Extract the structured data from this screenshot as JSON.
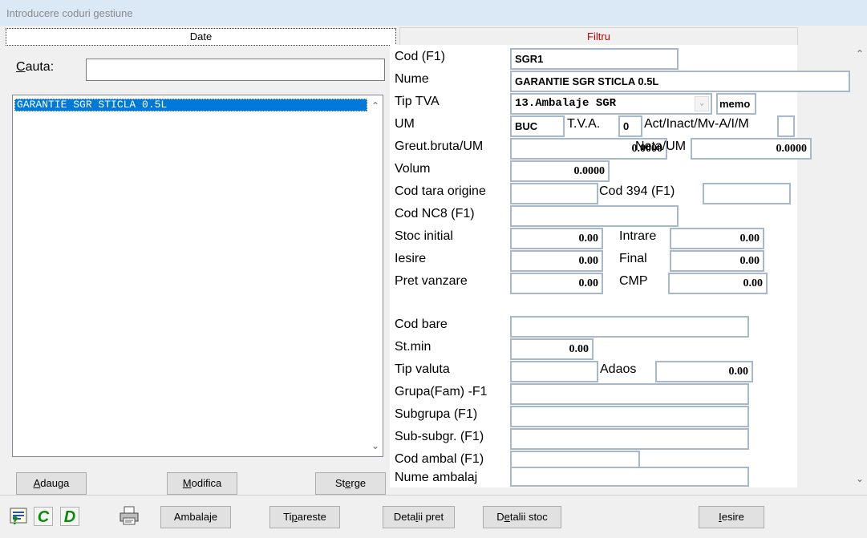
{
  "window": {
    "title": "Introducere coduri gestiune"
  },
  "tabs": {
    "date": "Date",
    "filtru": "Filtru"
  },
  "search": {
    "label_first": "C",
    "label_rest": "auta:",
    "value": ""
  },
  "list": {
    "items": [
      "GARANTIE SGR STICLA 0.5L"
    ]
  },
  "left_buttons": {
    "adauga_first": "A",
    "adauga_rest": "dauga",
    "modifica_first": "M",
    "modifica_rest": "odifica",
    "sterge_pre": "St",
    "sterge_u": "e",
    "sterge_post": "rge"
  },
  "form": {
    "cod_label": "Cod (F1)",
    "cod_value": "SGR1",
    "nume_label": "Nume",
    "nume_value": "GARANTIE SGR STICLA 0.5L",
    "tiptva_label": "Tip TVA",
    "tiptva_value": "13.Ambalaje SGR",
    "memo_value": "memo",
    "um_label": "UM",
    "um_value": "BUC",
    "tva_label": "T.V.A.",
    "tva_value": "0",
    "act_label": "Act/Inact/Mv-A/I/M",
    "act_value": "",
    "greut_label": "Greut.bruta/UM",
    "greut_value": "0.0000",
    "neta_label": "Neta/UM",
    "neta_value": "0.0000",
    "volum_label": "Volum",
    "volum_value": "0.0000",
    "tara_label": "Cod tara origine",
    "tara_value": "",
    "cod394_label": "Cod 394 (F1)",
    "cod394_value": "",
    "nc8_label": "Cod NC8 (F1)",
    "nc8_value": "",
    "stoc_label": "Stoc initial",
    "stoc_value": "0.00",
    "intrare_label": "Intrare",
    "intrare_value": "0.00",
    "iesire_label": "Iesire",
    "iesire_value": "0.00",
    "final_label": "Final",
    "final_value": "0.00",
    "pret_label": "Pret vanzare",
    "pret_value": "0.00",
    "cmp_label": "CMP",
    "cmp_value": "0.00",
    "codbare_label": "Cod bare",
    "codbare_value": "",
    "stmin_label": "St.min",
    "stmin_value": "0.00",
    "tipvaluta_label": "Tip valuta",
    "tipvaluta_value": "",
    "adaos_label": "Adaos",
    "adaos_value": "0.00",
    "grupa_label": "Grupa(Fam) -F1",
    "grupa_value": "",
    "subgrupa_label": "Subgrupa  (F1)",
    "subgrupa_value": "",
    "subsubgr_label": "Sub-subgr. (F1)",
    "subsubgr_value": "",
    "codambal_label": "Cod ambal (F1)",
    "codambal_value": "",
    "numeambalaj_label": "Nume ambalaj",
    "numeambalaj_value": ""
  },
  "bottom_bar": {
    "c_icon": "C",
    "d_icon": "D",
    "ambalaje": "Ambalaje",
    "tipareste_pre": "Ti",
    "tipareste_u": "p",
    "tipareste_post": "areste",
    "detalii_pret_pre": "Deta",
    "detalii_pret_u": "l",
    "detalii_pret_post": "ii pret",
    "detalii_stoc_pre": "D",
    "detalii_stoc_u": "e",
    "detalii_stoc_post": "talii stoc",
    "iesire_first": "I",
    "iesire_rest": "esire"
  },
  "colors": {
    "selection": "#0078d7",
    "field_border": "#a8b8cc",
    "filtru_text": "#c00000",
    "icon_green": "#0a8a0a"
  }
}
